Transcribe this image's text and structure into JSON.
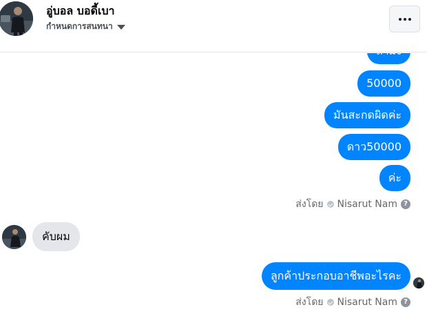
{
  "header": {
    "contact_name": "อู่บอล บอดี้เบา",
    "conversation_settings": "กำหนดการสนทนา"
  },
  "messages": {
    "outgoing_1": [
      "ถามง",
      "50000",
      "มันสะกดผิดค่ะ",
      "ดาว50000",
      "ค่ะ"
    ],
    "incoming": "คับผม",
    "outgoing_2": "ลูกค้าประกอบอาชีพอะไรคะ"
  },
  "sent_by": {
    "prefix": "ส่งโดย",
    "name": "Nisarut Nam",
    "help": "?"
  },
  "colors": {
    "outgoing_bubble": "#0084ff",
    "incoming_bubble": "#e4e6eb"
  }
}
